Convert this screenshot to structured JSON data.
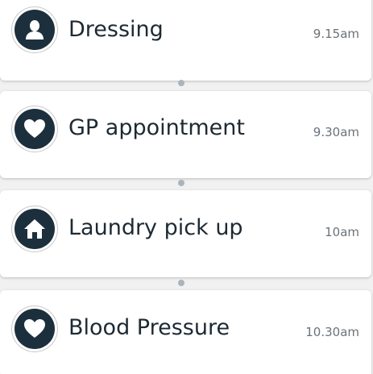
{
  "schedule": {
    "items": [
      {
        "title": "Dressing",
        "time": "9.15am",
        "icon": "person-icon"
      },
      {
        "title": "GP appointment",
        "time": "9.30am",
        "icon": "heart-icon"
      },
      {
        "title": "Laundry pick up",
        "time": "10am",
        "icon": "house-icon"
      },
      {
        "title": "Blood Pressure",
        "time": "10.30am",
        "icon": "heart-icon"
      }
    ]
  },
  "colors": {
    "icon_disc": "#1c2f3d",
    "title_text": "#1d2a33",
    "time_text": "#6b7379",
    "connector_dot": "#aab4bb",
    "background": "#f1f1f1"
  }
}
